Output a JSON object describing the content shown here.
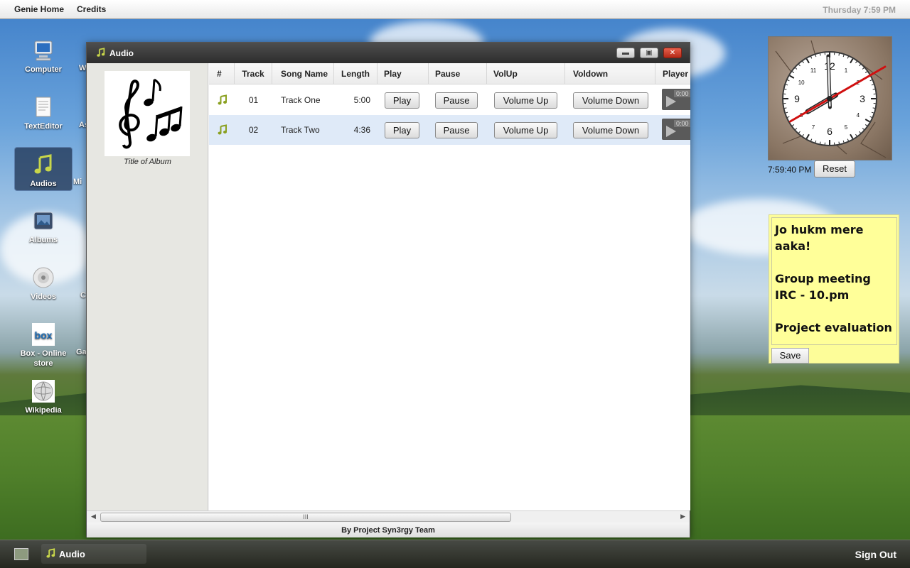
{
  "topbar": {
    "menu": [
      "Genie Home",
      "Credits"
    ],
    "clock": "Thursday 7:59 PM"
  },
  "desktop": {
    "icons": [
      {
        "label": "Computer",
        "icon": "computer-icon"
      },
      {
        "label": "TextEditor",
        "icon": "document-icon"
      },
      {
        "label": "Audios",
        "icon": "music-note-icon"
      },
      {
        "label": "Albums",
        "icon": "picture-icon"
      },
      {
        "label": "Videos",
        "icon": "disc-icon"
      },
      {
        "label": "Box - Online store",
        "icon": "box-logo-icon"
      },
      {
        "label": "Wikipedia",
        "icon": "wikipedia-globe-icon"
      }
    ],
    "partial_labels": [
      "W",
      "As",
      "Mi",
      "C",
      "Ga"
    ]
  },
  "window": {
    "title": "Audio",
    "album_caption": "Title of Album",
    "columns": [
      "#",
      "Track",
      "Song Name",
      "Length",
      "Play",
      "Pause",
      "VolUp",
      "Voldown",
      "Player"
    ],
    "tracks": [
      {
        "track": "01",
        "song": "Track One",
        "length": "5:00",
        "play": "Play",
        "pause": "Pause",
        "volup": "Volume Up",
        "voldown": "Volume Down",
        "player_time": "0:00"
      },
      {
        "track": "02",
        "song": "Track Two",
        "length": "4:36",
        "play": "Play",
        "pause": "Pause",
        "volup": "Volume Up",
        "voldown": "Volume Down",
        "player_time": "0:00"
      }
    ],
    "scroll_thumb": "III",
    "footer": "By Project Syn3rgy Team"
  },
  "clock_widget": {
    "time": "7:59:40 PM",
    "reset_label": "Reset"
  },
  "note": {
    "text": "Jo hukm mere aaka!\n\nGroup meeting IRC - 10.pm\n\nProject evaluation",
    "save_label": "Save"
  },
  "taskbar": {
    "task_label": "Audio",
    "signout_label": "Sign Out"
  },
  "colors": {
    "selected_row": "#dfeaf8",
    "close_button": "#c0392b",
    "note_bg": "#ffff99",
    "second_hand": "#d01010"
  }
}
